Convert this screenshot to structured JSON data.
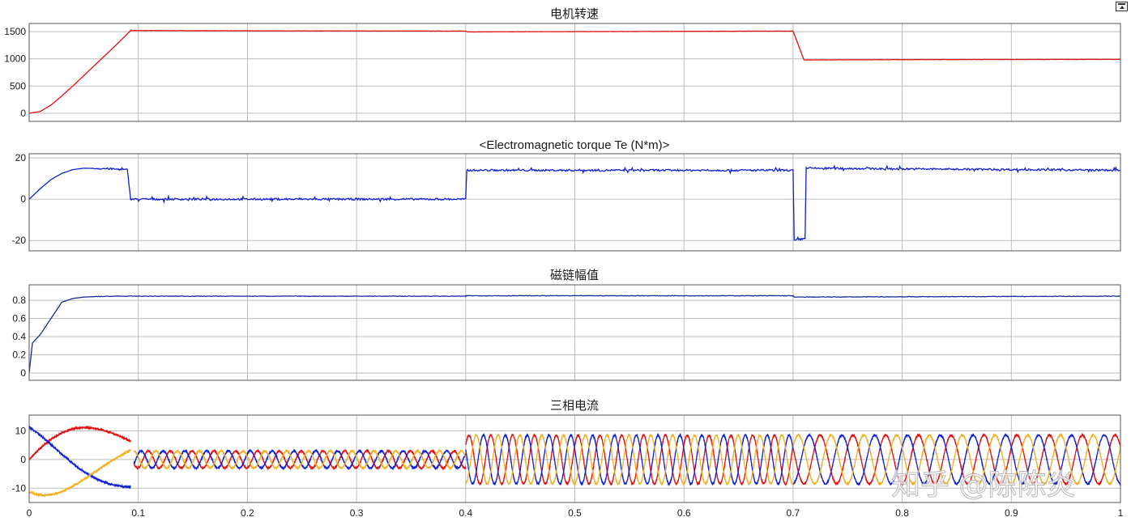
{
  "window": {
    "undock_icon": "undock-arrow-icon"
  },
  "watermark": "知乎 @陈陈炎",
  "colors": {
    "red": "#e01010",
    "blue": "#1020d0",
    "yellow": "#f0b020",
    "navy": "#1a2a9a",
    "grid": "#bcbcbc",
    "axis": "#555555"
  },
  "chart_data": [
    {
      "type": "line",
      "title": "电机转速",
      "xlim": [
        0,
        1
      ],
      "ylim": [
        -150,
        1650
      ],
      "yticks": [
        0,
        500,
        1000,
        1500
      ],
      "xticks": [
        0.1,
        0.2,
        0.3,
        0.4,
        0.5,
        0.6,
        0.7,
        0.8,
        0.9
      ],
      "show_xtick_labels": false,
      "grid": true,
      "series": [
        {
          "color": "red",
          "x": [
            0,
            0.01,
            0.02,
            0.03,
            0.04,
            0.05,
            0.06,
            0.07,
            0.08,
            0.093,
            0.2,
            0.4,
            0.402,
            0.6,
            0.7,
            0.71,
            0.8,
            1.0
          ],
          "y": [
            0,
            30,
            150,
            320,
            500,
            690,
            880,
            1070,
            1260,
            1520,
            1515,
            1510,
            1495,
            1505,
            1510,
            980,
            985,
            990
          ]
        }
      ]
    },
    {
      "type": "line",
      "title": "<Electromagnetic torque Te (N*m)>",
      "xlim": [
        0,
        1
      ],
      "ylim": [
        -25,
        22
      ],
      "yticks": [
        -20,
        0,
        20
      ],
      "xticks": [
        0.1,
        0.2,
        0.3,
        0.4,
        0.5,
        0.6,
        0.7,
        0.8,
        0.9
      ],
      "show_xtick_labels": false,
      "grid": true,
      "series": [
        {
          "color": "blue",
          "x": [
            0,
            0.01,
            0.02,
            0.03,
            0.04,
            0.05,
            0.07,
            0.09,
            0.093,
            0.096,
            0.4,
            0.401,
            0.7,
            0.701,
            0.711,
            0.712,
            1.0
          ],
          "y": [
            0,
            5,
            9.5,
            12.5,
            14.3,
            15,
            14.8,
            14.2,
            0,
            0,
            0,
            14,
            14,
            -20,
            -19,
            15,
            14
          ]
        }
      ]
    },
    {
      "type": "line",
      "title": "磁链幅值",
      "xlim": [
        0,
        1
      ],
      "ylim": [
        -0.08,
        0.97
      ],
      "yticks": [
        0,
        0.2,
        0.4,
        0.6,
        0.8
      ],
      "xticks": [
        0.1,
        0.2,
        0.3,
        0.4,
        0.5,
        0.6,
        0.7,
        0.8,
        0.9
      ],
      "show_xtick_labels": false,
      "grid": true,
      "series": [
        {
          "color": "navy",
          "x": [
            0,
            0.003,
            0.01,
            0.02,
            0.03,
            0.04,
            0.05,
            0.06,
            0.08,
            0.1,
            0.4,
            0.401,
            0.7,
            0.701,
            1.0
          ],
          "y": [
            0,
            0.33,
            0.42,
            0.6,
            0.78,
            0.82,
            0.835,
            0.84,
            0.845,
            0.845,
            0.845,
            0.85,
            0.85,
            0.835,
            0.845
          ]
        }
      ]
    },
    {
      "type": "line",
      "title": "三相电流",
      "xlim": [
        0,
        1
      ],
      "ylim": [
        -15,
        15.5
      ],
      "yticks": [
        -10,
        0,
        10
      ],
      "xticks": [
        0,
        0.1,
        0.2,
        0.3,
        0.4,
        0.5,
        0.6,
        0.7,
        0.8,
        0.9,
        1
      ],
      "xtick_labels": [
        "0",
        "0.1",
        "0.2",
        "0.3",
        "0.4",
        "0.5",
        "0.6",
        "0.7",
        "0.8",
        "0.9",
        "1"
      ],
      "grid": true,
      "series": [
        {
          "color": "red",
          "phase_deg": 0,
          "segments": [
            [
              0,
              0.093,
              13,
              5,
              3.3
            ],
            [
              0.096,
              0.4,
              3,
              50,
              50
            ],
            [
              0.4,
              0.7,
              8.5,
              50,
              50
            ],
            [
              0.7,
              1.0,
              8.5,
              33.3,
              33.3
            ]
          ]
        },
        {
          "color": "blue",
          "phase_deg": 120,
          "segments": [
            [
              0,
              0.093,
              13,
              5,
              3.3
            ],
            [
              0.096,
              0.4,
              3,
              50,
              50
            ],
            [
              0.4,
              0.7,
              8.5,
              50,
              50
            ],
            [
              0.7,
              1.0,
              8.5,
              33.3,
              33.3
            ]
          ]
        },
        {
          "color": "yellow",
          "phase_deg": 240,
          "segments": [
            [
              0,
              0.093,
              13,
              5,
              3.3
            ],
            [
              0.096,
              0.4,
              3,
              50,
              50
            ],
            [
              0.4,
              0.7,
              8.5,
              50,
              50
            ],
            [
              0.7,
              1.0,
              8.5,
              33.3,
              33.3
            ]
          ]
        }
      ]
    }
  ]
}
